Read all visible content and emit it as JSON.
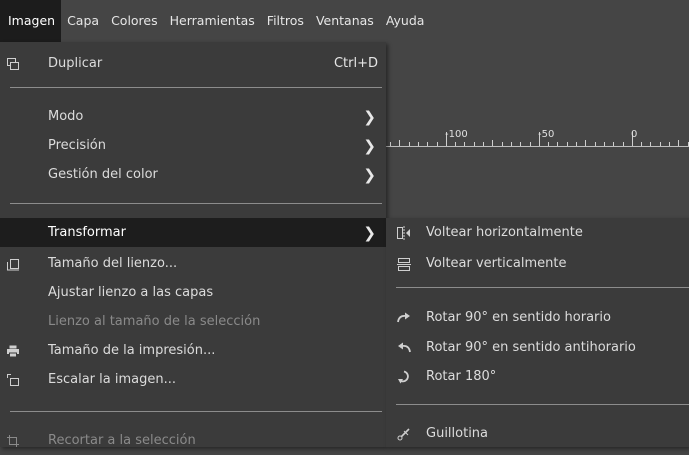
{
  "menubar": {
    "items": [
      "Imagen",
      "Capa",
      "Colores",
      "Herramientas",
      "Filtros",
      "Ventanas",
      "Ayuda"
    ],
    "active_index": 0
  },
  "ruler": {
    "labels": [
      "-100",
      "-50",
      "0"
    ]
  },
  "image_menu": {
    "duplicate": {
      "label": "Duplicar",
      "shortcut": "Ctrl+D",
      "icon": "duplicate-icon"
    },
    "mode": {
      "label": "Modo"
    },
    "precision": {
      "label": "Precisión"
    },
    "color_management": {
      "label": "Gestión del color"
    },
    "transform": {
      "label": "Transformar"
    },
    "canvas_size": {
      "label": "Tamaño del lienzo...",
      "icon": "canvas-size-icon"
    },
    "fit_canvas_layers": {
      "label": "Ajustar lienzo a las capas"
    },
    "canvas_to_selection": {
      "label": "Lienzo al tamaño de la selección"
    },
    "print_size": {
      "label": "Tamaño de la impresión...",
      "icon": "printer-icon"
    },
    "scale_image": {
      "label": "Escalar la imagen...",
      "icon": "scale-image-icon"
    },
    "crop_to_selection": {
      "label": "Recortar a la selección",
      "icon": "crop-icon"
    }
  },
  "transform_submenu": {
    "flip_horizontal": {
      "label": "Voltear horizontalmente",
      "icon": "flip-horizontal-icon"
    },
    "flip_vertical": {
      "label": "Voltear verticalmente",
      "icon": "flip-vertical-icon"
    },
    "rotate_cw": {
      "label": "Rotar 90° en sentido horario",
      "icon": "rotate-cw-icon"
    },
    "rotate_ccw": {
      "label": "Rotar 90° en sentido antihorario",
      "icon": "rotate-ccw-icon"
    },
    "rotate_180": {
      "label": "Rotar 180°",
      "icon": "rotate-180-icon"
    },
    "guillotine": {
      "label": "Guillotina",
      "icon": "guillotine-icon"
    }
  },
  "colors": {
    "background": "#454545",
    "menu_bg": "#3b3b3b",
    "highlight_bg": "#1d1d1d",
    "text": "#dcdcdc",
    "disabled_text": "#8a8a8a"
  }
}
